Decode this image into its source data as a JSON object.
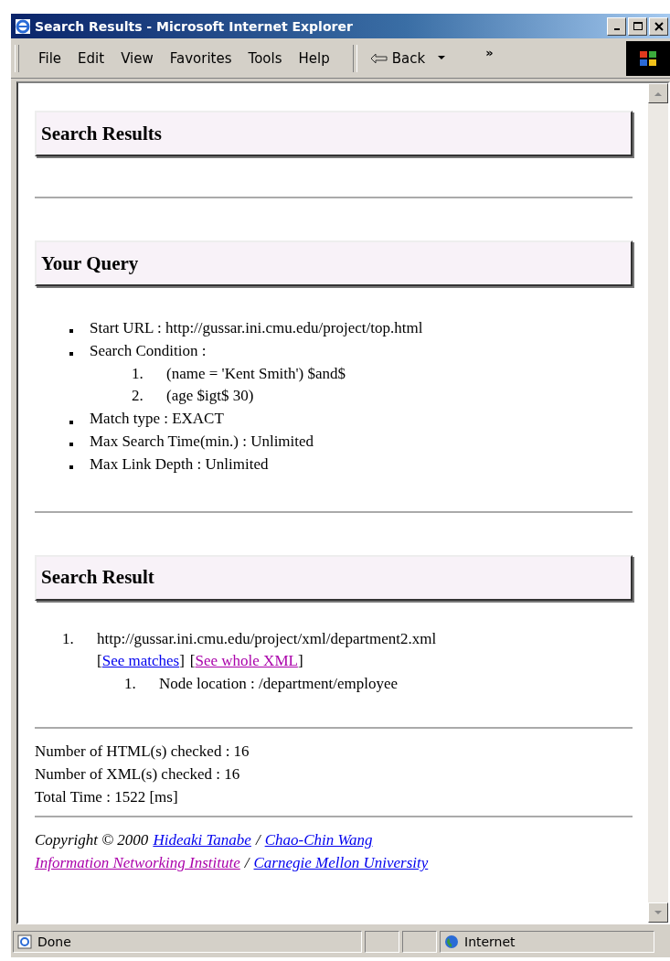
{
  "window": {
    "title": "Search Results - Microsoft Internet Explorer"
  },
  "menu": [
    "File",
    "Edit",
    "View",
    "Favorites",
    "Tools",
    "Help"
  ],
  "toolbar": {
    "back": "Back",
    "chevron": "»"
  },
  "sections": [
    {
      "heading": "Search Results"
    },
    {
      "heading": "Your Query"
    },
    {
      "heading": "Search Result"
    }
  ],
  "query": [
    {
      "kind": "item",
      "text": "Start URL : http://gussar.ini.cmu.edu/project/top.html"
    },
    {
      "kind": "item",
      "text": "Search Condition :",
      "children": [
        {
          "num": "1.",
          "text": "(name = 'Kent Smith') $and$"
        },
        {
          "num": "2.",
          "text": "(age $igt$ 30)"
        }
      ]
    },
    {
      "kind": "item",
      "text": "Match type : EXACT"
    },
    {
      "kind": "item",
      "text": "Max Search Time(min.) : Unlimited"
    },
    {
      "kind": "item",
      "text": "Max Link Depth : Unlimited"
    }
  ],
  "results": [
    {
      "num": "1.",
      "url": "http://gussar.ini.cmu.edu/project/xml/department2.xml",
      "links": [
        {
          "open": "[",
          "label": "See matches",
          "close": "]",
          "visited": false
        },
        {
          "open": "[",
          "label": "See whole XML",
          "close": "]",
          "visited": true
        }
      ],
      "nodes": [
        {
          "num": "1.",
          "text": "Node location : /department/employee"
        }
      ]
    }
  ],
  "stats": [
    "Number of HTML(s) checked : 16",
    "Number of XML(s) checked : 16",
    "Total Time : 1522 [ms]"
  ],
  "footer": [
    {
      "lead": "Copyright © 2000",
      "links": [
        {
          "label": "Hideaki Tanabe",
          "visited": false
        },
        {
          "label": "Chao-Chin Wang",
          "visited": false
        }
      ]
    },
    {
      "links": [
        {
          "label": "Information Networking Institute",
          "visited": true
        },
        {
          "label": "Carnegie Mellon University",
          "visited": false
        }
      ]
    }
  ],
  "separator": "/",
  "status_bar": {
    "text": "Done",
    "zone": "Internet"
  }
}
